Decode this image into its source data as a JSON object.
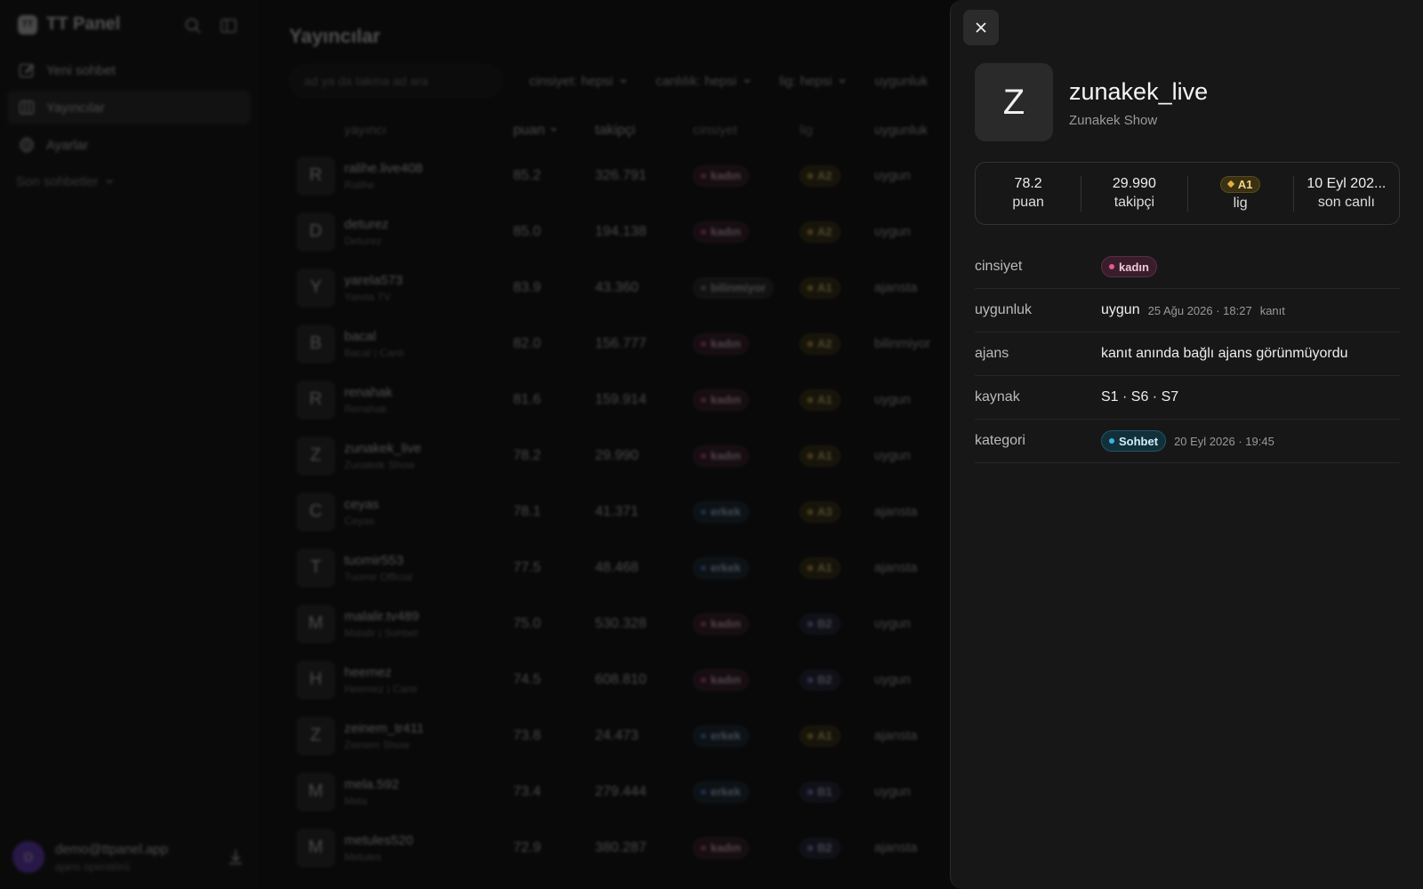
{
  "sidebar": {
    "brand_logo": "TT",
    "brand_name": "TT Panel",
    "nav": [
      {
        "label": "Yeni sohbet",
        "icon": "edit-icon"
      },
      {
        "label": "Yayıncılar",
        "icon": "columns-icon",
        "active": true
      },
      {
        "label": "Ayarlar",
        "icon": "gear-icon"
      }
    ],
    "section_label": "Son sohbetler",
    "user": {
      "initial": "D",
      "email": "demo@ttpanel.app",
      "role": "ajans operatörü"
    }
  },
  "main": {
    "title": "Yayıncılar",
    "search_placeholder": "ad ya da takma ad ara",
    "filters": [
      "cinsiyet: hepsi",
      "canlılık: hepsi",
      "lig: hepsi",
      "uygunluk"
    ],
    "columns": {
      "name": "yayıncı",
      "score": "puan",
      "followers": "takipçi",
      "gender": "cinsiyet",
      "league": "lig",
      "fit": "uygunluk"
    },
    "rows": [
      {
        "initial": "R",
        "name": "ralihe.live408",
        "display": "Ralihe",
        "score": "85.2",
        "followers": "326.791",
        "gender": "kadın",
        "gclass": "kadin",
        "league": "A2",
        "lclass": "lA",
        "fit": "uygun"
      },
      {
        "initial": "D",
        "name": "deturez",
        "display": "Deturez",
        "score": "85.0",
        "followers": "194.138",
        "gender": "kadın",
        "gclass": "kadin",
        "league": "A2",
        "lclass": "lA",
        "fit": "uygun"
      },
      {
        "initial": "Y",
        "name": "yarela573",
        "display": "Yarela TV",
        "score": "83.9",
        "followers": "43.360",
        "gender": "bilinmiyor",
        "gclass": "bilinmiyor",
        "league": "A1",
        "lclass": "lA",
        "fit": "ajansta"
      },
      {
        "initial": "B",
        "name": "bacal",
        "display": "Bacal | Canlı",
        "score": "82.0",
        "followers": "156.777",
        "gender": "kadın",
        "gclass": "kadin",
        "league": "A2",
        "lclass": "lA",
        "fit": "bilinmiyor"
      },
      {
        "initial": "R",
        "name": "renahak",
        "display": "Renahak",
        "score": "81.6",
        "followers": "159.914",
        "gender": "kadın",
        "gclass": "kadin",
        "league": "A1",
        "lclass": "lA",
        "fit": "uygun"
      },
      {
        "initial": "Z",
        "name": "zunakek_live",
        "display": "Zunakek Show",
        "score": "78.2",
        "followers": "29.990",
        "gender": "kadın",
        "gclass": "kadin",
        "league": "A1",
        "lclass": "lA",
        "fit": "uygun"
      },
      {
        "initial": "C",
        "name": "ceyas",
        "display": "Ceyas",
        "score": "78.1",
        "followers": "41.371",
        "gender": "erkek",
        "gclass": "erkek",
        "league": "A3",
        "lclass": "lA",
        "fit": "ajansta"
      },
      {
        "initial": "T",
        "name": "tuomir553",
        "display": "Tuomir Official",
        "score": "77.5",
        "followers": "48.468",
        "gender": "erkek",
        "gclass": "erkek",
        "league": "A1",
        "lclass": "lA",
        "fit": "ajansta"
      },
      {
        "initial": "M",
        "name": "malalir.tv489",
        "display": "Malalir | Sohbet",
        "score": "75.0",
        "followers": "530.328",
        "gender": "kadın",
        "gclass": "kadin",
        "league": "B2",
        "lclass": "lB",
        "fit": "uygun"
      },
      {
        "initial": "H",
        "name": "heemez",
        "display": "Heemez | Canlı",
        "score": "74.5",
        "followers": "608.810",
        "gender": "kadın",
        "gclass": "kadin",
        "league": "B2",
        "lclass": "lB",
        "fit": "uygun"
      },
      {
        "initial": "Z",
        "name": "zeinem_tr411",
        "display": "Zeinem Show",
        "score": "73.8",
        "followers": "24.473",
        "gender": "erkek",
        "gclass": "erkek",
        "league": "A1",
        "lclass": "lA",
        "fit": "ajansta"
      },
      {
        "initial": "M",
        "name": "mela.592",
        "display": "Mela",
        "score": "73.4",
        "followers": "279.444",
        "gender": "erkek",
        "gclass": "erkek",
        "league": "B1",
        "lclass": "lB",
        "fit": "uygun"
      },
      {
        "initial": "M",
        "name": "metules520",
        "display": "Metules",
        "score": "72.9",
        "followers": "380.287",
        "gender": "kadın",
        "gclass": "kadin",
        "league": "B2",
        "lclass": "lB",
        "fit": "ajansta"
      }
    ]
  },
  "panel": {
    "avatar_initial": "Z",
    "handle": "zunakek_live",
    "display_name": "Zunakek Show",
    "stats": {
      "score": {
        "value": "78.2",
        "label": "puan"
      },
      "followers": {
        "value": "29.990",
        "label": "takipçi"
      },
      "league": {
        "value": "A1",
        "label": "lig"
      },
      "last_live": {
        "value": "10 Eyl 202...",
        "label": "son canlı"
      }
    },
    "details": {
      "gender": {
        "key": "cinsiyet",
        "value": "kadın"
      },
      "fit": {
        "key": "uygunluk",
        "value": "uygun",
        "date": "25 Ağu 2026 · 18:27",
        "proof": "kanıt"
      },
      "agency": {
        "key": "ajans",
        "value": "kanıt anında bağlı ajans görünmüyordu"
      },
      "source": {
        "key": "kaynak",
        "value": "S1 · S6 · S7"
      },
      "category": {
        "key": "kategori",
        "value": "Sohbet",
        "date": "20 Eyl 2026 · 19:45"
      }
    }
  },
  "colors": {
    "accent_purple": "#6d3fd6",
    "kadin": "#e05a95",
    "erkek": "#4a8be0",
    "league_a": "#e0b040",
    "league_b": "#8a8ae0",
    "category": "#3bb5e8"
  }
}
